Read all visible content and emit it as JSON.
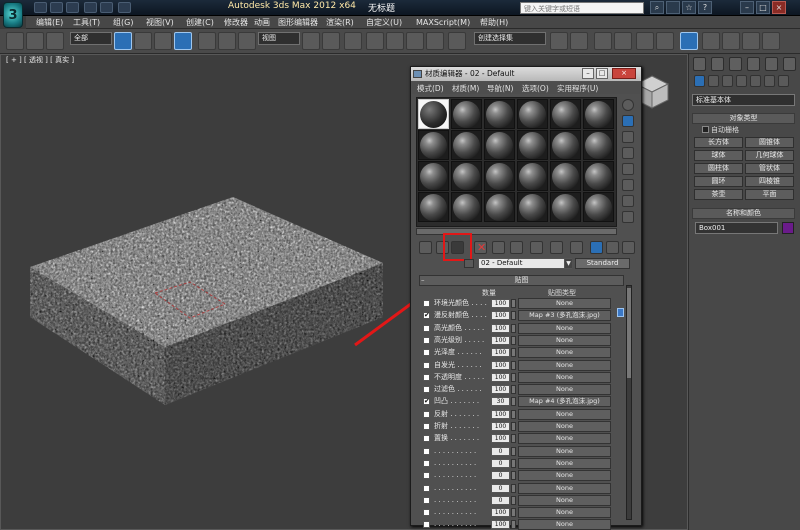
{
  "app": {
    "title": "Autodesk 3ds Max  2012 x64",
    "document": "无标题",
    "help_search_placeholder": "键入关键字或短语"
  },
  "menu": [
    "编辑(E)",
    "工具(T)",
    "组(G)",
    "视图(V)",
    "创建(C)",
    "修改器",
    "动画",
    "图形编辑器",
    "渲染(R)",
    "自定义(U)",
    "MAXScript(M)",
    "帮助(H)"
  ],
  "toolbar": {
    "selection_filter": "全部",
    "reference_coord": "视图",
    "named_selection": "创建选择集"
  },
  "viewport": {
    "label": "[ + ] [ 透视 ] [ 真实 ]"
  },
  "command_panel": {
    "category": "标准基本体",
    "object_type_header": "对象类型",
    "autogrid": "自动栅格",
    "buttons": [
      "长方体",
      "圆锥体",
      "球体",
      "几何球体",
      "圆柱体",
      "管状体",
      "圆环",
      "四棱锥",
      "茶壶",
      "平面"
    ],
    "name_color_header": "名称和颜色",
    "object_name": "Box001",
    "object_color": "#6a1b8a"
  },
  "material_editor": {
    "title": "材质编辑器 - 02 - Default",
    "menu": [
      "模式(D)",
      "材质(M)",
      "导航(N)",
      "选项(O)",
      "实用程序(U)"
    ],
    "material_name": "02 - Default",
    "material_type": "Standard",
    "maps_rollout": "贴图",
    "col_amount": "数量",
    "col_maptype": "贴图类型",
    "maps": [
      {
        "label": "环境光颜色 . . . .",
        "checked": false,
        "amount": "100",
        "map": "None"
      },
      {
        "label": "漫反射颜色 . . . .",
        "checked": true,
        "amount": "100",
        "map": "Map #3 (多孔泡沫.jpg)"
      },
      {
        "label": "高光颜色 . . . . .",
        "checked": false,
        "amount": "100",
        "map": "None"
      },
      {
        "label": "高光级别 . . . . .",
        "checked": false,
        "amount": "100",
        "map": "None"
      },
      {
        "label": "光泽度 . . . . . .",
        "checked": false,
        "amount": "100",
        "map": "None"
      },
      {
        "label": "自发光 . . . . . .",
        "checked": false,
        "amount": "100",
        "map": "None"
      },
      {
        "label": "不透明度 . . . . .",
        "checked": false,
        "amount": "100",
        "map": "None"
      },
      {
        "label": "过滤色 . . . . . .",
        "checked": false,
        "amount": "100",
        "map": "None"
      },
      {
        "label": "凹凸 . . . . . . .",
        "checked": true,
        "amount": "30",
        "map": "Map #4 (多孔泡沫.jpg)"
      },
      {
        "label": "反射 . . . . . . .",
        "checked": false,
        "amount": "100",
        "map": "None"
      },
      {
        "label": "折射 . . . . . . .",
        "checked": false,
        "amount": "100",
        "map": "None"
      },
      {
        "label": "置换 . . . . . . .",
        "checked": false,
        "amount": "100",
        "map": "None"
      },
      {
        "label": ". . . . . . . . . .",
        "checked": false,
        "amount": "0",
        "map": "None"
      },
      {
        "label": ". . . . . . . . . .",
        "checked": false,
        "amount": "0",
        "map": "None"
      },
      {
        "label": ". . . . . . . . . .",
        "checked": false,
        "amount": "0",
        "map": "None"
      },
      {
        "label": ". . . . . . . . . .",
        "checked": false,
        "amount": "0",
        "map": "None"
      },
      {
        "label": ". . . . . . . . . .",
        "checked": false,
        "amount": "0",
        "map": "None"
      },
      {
        "label": ". . . . . . . . . .",
        "checked": false,
        "amount": "100",
        "map": "None"
      },
      {
        "label": ". . . . . . . . . .",
        "checked": false,
        "amount": "100",
        "map": "None"
      }
    ]
  },
  "annotation": {
    "highlight_color": "#e21717",
    "target": "get-material-button"
  }
}
